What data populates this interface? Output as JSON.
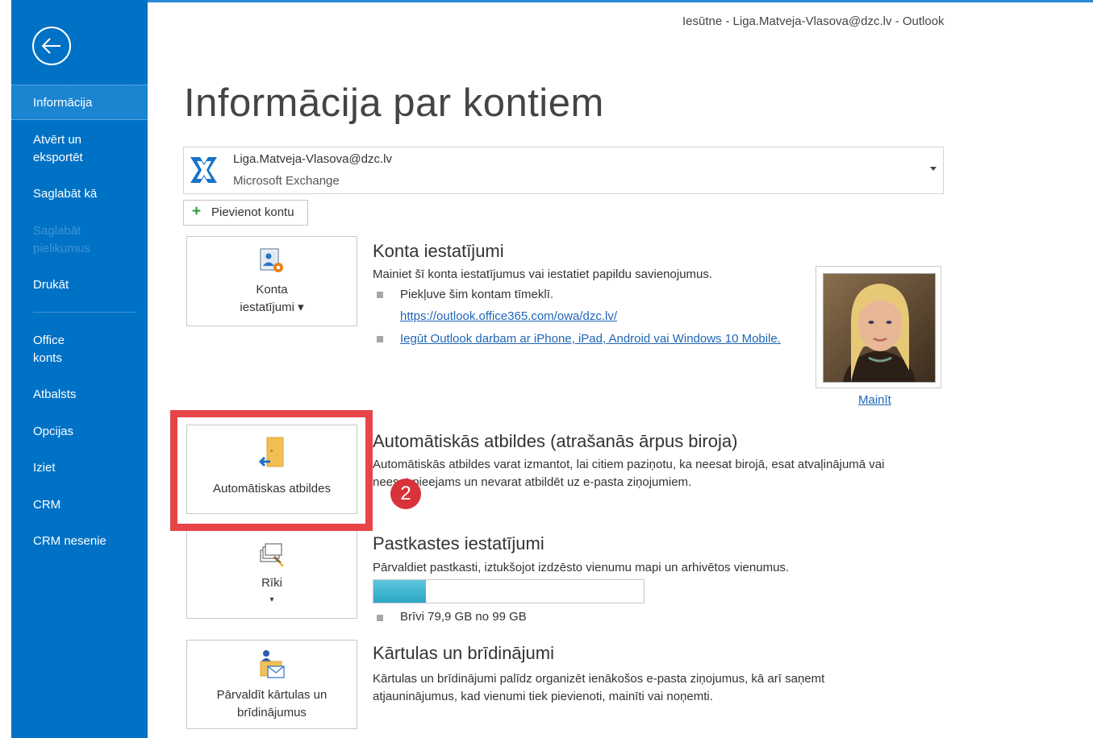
{
  "window": {
    "title": "Iesūtne - Liga.Matveja-Vlasova@dzc.lv  -  Outlook"
  },
  "sidebar": {
    "back_icon": "arrow-left-circle-icon",
    "items": [
      {
        "label": "Informācija",
        "active": true
      },
      {
        "label": "Atvērt un eksportēt"
      },
      {
        "label": "Saglabāt kā"
      },
      {
        "label": "Saglabāt pielikumus",
        "disabled": true
      },
      {
        "label": "Drukāt"
      },
      {
        "label": "Office konts"
      },
      {
        "label": "Atbalsts"
      },
      {
        "label": "Opcijas"
      },
      {
        "label": "Iziet"
      },
      {
        "label": "CRM"
      },
      {
        "label": "CRM nesenie"
      }
    ]
  },
  "page": {
    "title": "Informācija par kontiem"
  },
  "account": {
    "email": "Liga.Matveja-Vlasova@dzc.lv",
    "type": "Microsoft Exchange",
    "icon": "exchange-icon"
  },
  "add_account": {
    "label": "Pievienot kontu"
  },
  "account_settings": {
    "tile_label_line1": "Konta",
    "tile_label_line2": "iestatījumi ▾",
    "title": "Konta iestatījumi",
    "description": "Mainiet šī konta iestatījumus vai iestatiet papildu savienojumus.",
    "bullet1": "Piekļuve šim kontam tīmeklī.",
    "owa_link": "https://outlook.office365.com/owa/dzc.lv/",
    "mobile_link": "Iegūt Outlook darbam ar iPhone, iPad, Android vai Windows 10 Mobile.",
    "change_photo": "Mainīt"
  },
  "auto_replies": {
    "tile_label": "Automātiskas atbildes",
    "title": "Automātiskās atbildes (atrašanās ārpus biroja)",
    "description_line1": "Automātiskās atbildes varat izmantot, lai citiem paziņotu, ka neesat birojā, esat atvaļinājumā vai",
    "description_line2": "neesat pieejams un nevarat atbildēt uz e-pasta ziņojumiem."
  },
  "mailbox": {
    "tile_label": "Rīki",
    "title": "Pastkastes iestatījumi",
    "description": "Pārvaldiet pastkasti, iztukšojot izdzēsto vienumu mapi un arhivētos vienumus.",
    "used_fraction": 0.193,
    "free_text": "Brīvi 79,9 GB no 99 GB"
  },
  "rules": {
    "tile_label_line1": "Pārvaldīt kārtulas un",
    "tile_label_line2": "brīdinājumus",
    "title": "Kārtulas un brīdinājumi",
    "description_line1": "Kārtulas un brīdinājumi palīdz organizēt ienākošos e-pasta ziņojumus, kā arī saņemt",
    "description_line2": "atjauninājumus, kad vienumi tiek pievienoti, mainīti vai noņemti."
  },
  "annotation": {
    "step": "2",
    "highlight_color": "#e84548"
  }
}
